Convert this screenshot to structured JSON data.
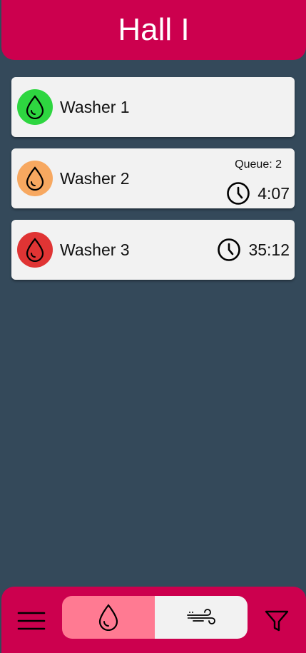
{
  "header": {
    "title": "Hall I"
  },
  "machines": [
    {
      "name": "Washer 1",
      "status_color": "#2ed640"
    },
    {
      "name": "Washer 2",
      "status_color": "#f7a860",
      "queue": "Queue: 2",
      "time": "4:07"
    },
    {
      "name": "Washer 3",
      "status_color": "#e03434",
      "time": "35:12"
    }
  ],
  "bottom_nav": {
    "menu_icon": "hamburger-menu-icon",
    "tabs": [
      {
        "icon": "water-drop-icon",
        "active": true
      },
      {
        "icon": "wind-icon",
        "active": false
      }
    ],
    "filter_icon": "filter-icon"
  },
  "colors": {
    "brand": "#cc004e",
    "background": "#34495a",
    "card": "#f2f2f2",
    "active_tab": "#ff7a92"
  }
}
